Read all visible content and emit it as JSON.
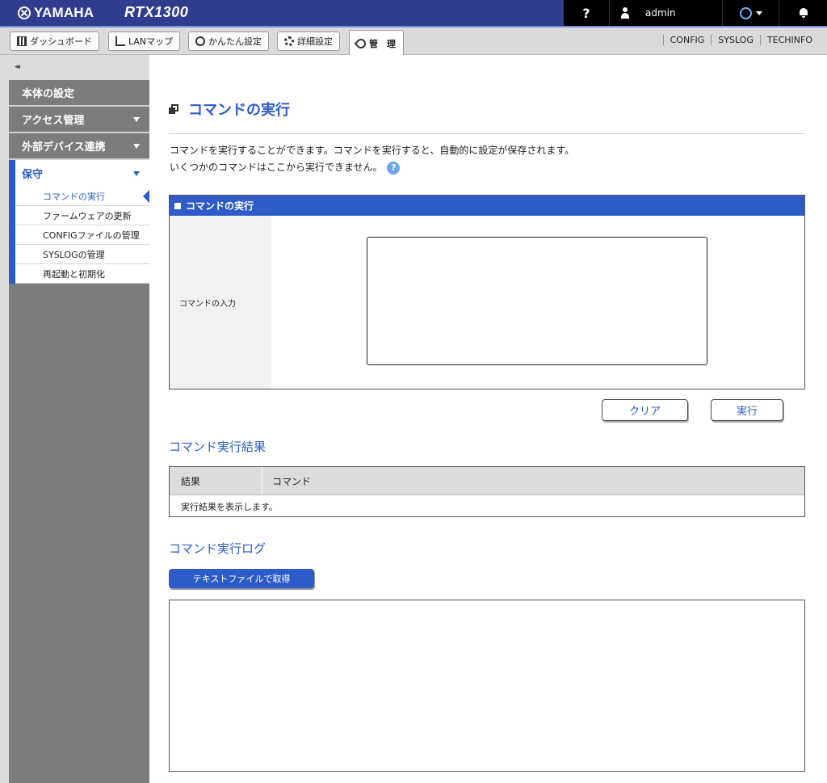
{
  "header": {
    "brand": "YAMAHA",
    "model": "RTX1300",
    "help": "?",
    "user": "admin"
  },
  "tabs": [
    {
      "label": "ダッシュボード",
      "icon": "dashboard-icon"
    },
    {
      "label": "LANマップ",
      "icon": "lan-map-icon"
    },
    {
      "label": "かんたん設定",
      "icon": "easy-setup-icon"
    },
    {
      "label": "詳細設定",
      "icon": "gear-icon"
    },
    {
      "label": "管　理",
      "icon": "wrench-icon"
    }
  ],
  "top_links": [
    "CONFIG",
    "SYSLOG",
    "TECHINFO"
  ],
  "sidebar": {
    "collapse": "◂◂",
    "sections": [
      {
        "label": "本体の設定"
      },
      {
        "label": "アクセス管理"
      },
      {
        "label": "外部デバイス連携"
      }
    ],
    "active_section": "保守",
    "sub_items": [
      "コマンドの実行",
      "ファームウェアの更新",
      "CONFIGファイルの管理",
      "SYSLOGの管理",
      "再起動と初期化"
    ]
  },
  "main": {
    "title": "コマンドの実行",
    "desc_line1": "コマンドを実行することができます。コマンドを実行すると、自動的に設定が保存されます。",
    "desc_line2": "いくつかのコマンドはここから実行できません。",
    "panel_title": "コマンドの実行",
    "input_label": "コマンドの入力",
    "input_value": "",
    "clear_button": "クリア",
    "run_button": "実行",
    "result_title": "コマンド実行結果",
    "result_table": {
      "headers": [
        "結果",
        "コマンド"
      ],
      "message": "実行結果を表示します。"
    },
    "log_title": "コマンド実行ログ",
    "download_button": "テキストファイルで取得"
  },
  "colors": {
    "accent": "#2d5cc8",
    "header_bg": "#2f3d8f",
    "sidebar_bg": "#7c7c7c"
  }
}
